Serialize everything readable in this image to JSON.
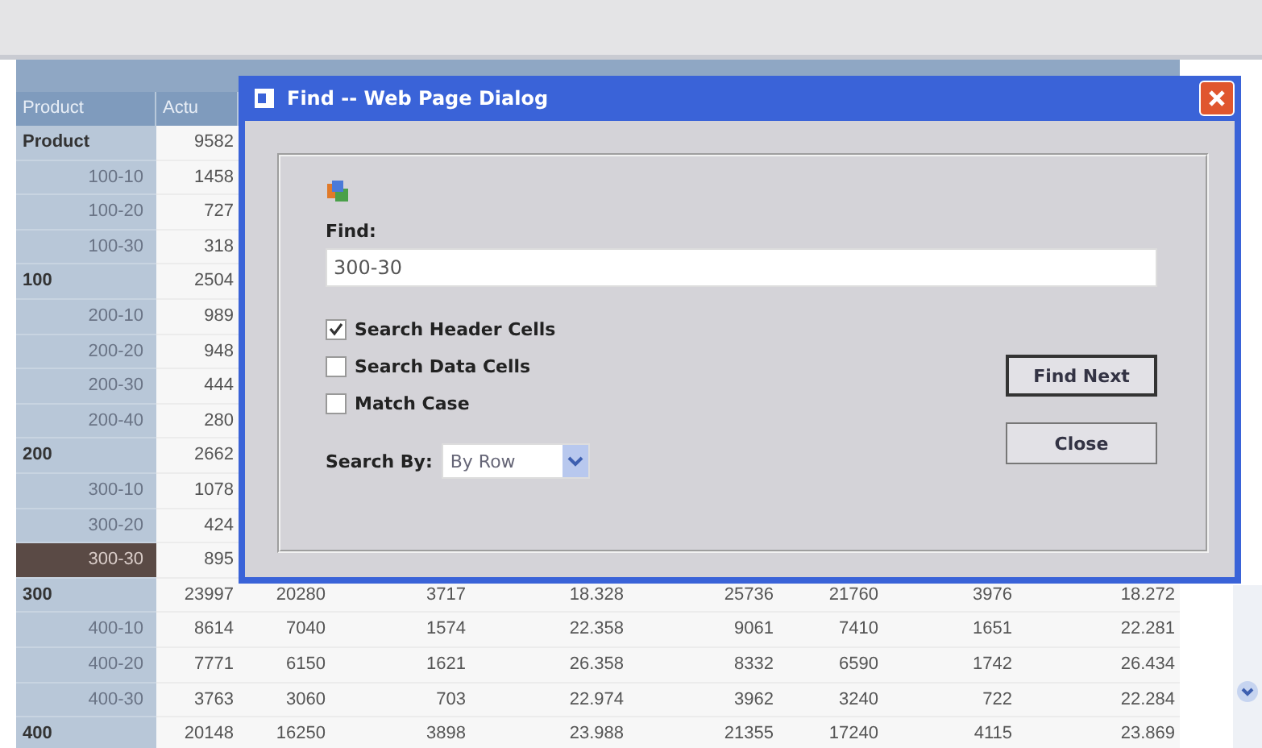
{
  "table": {
    "columns": [
      "Product",
      "Actu"
    ],
    "rows": [
      {
        "label": "Product",
        "kind": "total",
        "selected": false,
        "values": [
          "9582"
        ]
      },
      {
        "label": "100-10",
        "kind": "member",
        "selected": false,
        "values": [
          "1458"
        ]
      },
      {
        "label": "100-20",
        "kind": "member",
        "selected": false,
        "values": [
          "727"
        ]
      },
      {
        "label": "100-30",
        "kind": "member",
        "selected": false,
        "values": [
          "318"
        ]
      },
      {
        "label": "100",
        "kind": "total",
        "selected": false,
        "values": [
          "2504"
        ]
      },
      {
        "label": "200-10",
        "kind": "member",
        "selected": false,
        "values": [
          "989"
        ]
      },
      {
        "label": "200-20",
        "kind": "member",
        "selected": false,
        "values": [
          "948"
        ]
      },
      {
        "label": "200-30",
        "kind": "member",
        "selected": false,
        "values": [
          "444"
        ]
      },
      {
        "label": "200-40",
        "kind": "member",
        "selected": false,
        "values": [
          "280"
        ]
      },
      {
        "label": "200",
        "kind": "total",
        "selected": false,
        "values": [
          "2662"
        ]
      },
      {
        "label": "300-10",
        "kind": "member",
        "selected": false,
        "values": [
          "1078"
        ]
      },
      {
        "label": "300-20",
        "kind": "member",
        "selected": false,
        "values": [
          "424"
        ]
      },
      {
        "label": "300-30",
        "kind": "member",
        "selected": true,
        "values": [
          "895"
        ]
      },
      {
        "label": "300",
        "kind": "total",
        "selected": false,
        "values": [
          "23997",
          "20280",
          "3717",
          "18.328",
          "25736",
          "21760",
          "3976",
          "18.272"
        ]
      },
      {
        "label": "400-10",
        "kind": "member",
        "selected": false,
        "values": [
          "8614",
          "7040",
          "1574",
          "22.358",
          "9061",
          "7410",
          "1651",
          "22.281"
        ]
      },
      {
        "label": "400-20",
        "kind": "member",
        "selected": false,
        "values": [
          "7771",
          "6150",
          "1621",
          "26.358",
          "8332",
          "6590",
          "1742",
          "26.434"
        ]
      },
      {
        "label": "400-30",
        "kind": "member",
        "selected": false,
        "values": [
          "3763",
          "3060",
          "703",
          "22.974",
          "3962",
          "3240",
          "722",
          "22.284"
        ]
      },
      {
        "label": "400",
        "kind": "total",
        "selected": false,
        "values": [
          "20148",
          "16250",
          "3898",
          "23.988",
          "21355",
          "17240",
          "4115",
          "23.869"
        ]
      }
    ]
  },
  "dialog": {
    "title": "Find -- Web Page Dialog",
    "find_label": "Find:",
    "find_value": "300-30",
    "options": [
      {
        "label": "Search Header Cells",
        "checked": true
      },
      {
        "label": "Search Data Cells",
        "checked": false
      },
      {
        "label": "Match Case",
        "checked": false
      }
    ],
    "search_by_label": "Search By:",
    "search_by_value": "By Row",
    "buttons": [
      {
        "label": "Find Next",
        "default": true
      },
      {
        "label": "Close",
        "default": false
      }
    ]
  }
}
